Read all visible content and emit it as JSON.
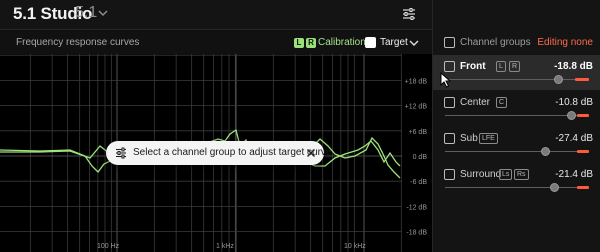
{
  "header": {
    "title": "5.1 Studio",
    "subtitle": "5.1"
  },
  "chart": {
    "title": "Frequency response curves",
    "calibration_chips": [
      "L",
      "R"
    ],
    "calibration_label": "Calibration",
    "target_label": "Target",
    "target_checked": true,
    "y_tick_labels": [
      "+18 dB",
      "+12 dB",
      "+6 dB",
      "0 dB",
      "-6 dB",
      "-12 dB",
      "-18 dB"
    ],
    "x_tick_labels": [
      "100 Hz",
      "1 kHz",
      "10 kHz"
    ],
    "curve_color": "#9fe27d",
    "grid_color": "#3a3a3a"
  },
  "tooltip": {
    "text": "Select a channel group to adjust target curve"
  },
  "panel": {
    "title": "Channel groups",
    "editing_status": "Editing none",
    "accent_color": "#ff5a3c",
    "groups": [
      {
        "name": "Front",
        "badges": [
          "L",
          "R"
        ],
        "db": "-18.8 dB",
        "selected": true,
        "level": 0.75
      },
      {
        "name": "Center",
        "badges": [
          "C"
        ],
        "db": "-10.8 dB",
        "selected": false,
        "level": 0.9
      },
      {
        "name": "Sub",
        "badges": [
          "LFE"
        ],
        "db": "-27.4 dB",
        "selected": false,
        "level": 0.62
      },
      {
        "name": "Surround",
        "badges": [
          "Ls",
          "Rs"
        ],
        "db": "-21.4 dB",
        "selected": false,
        "level": 0.74
      }
    ]
  }
}
